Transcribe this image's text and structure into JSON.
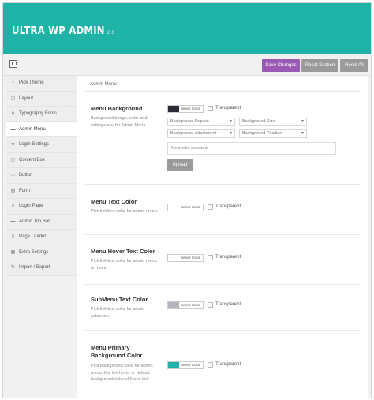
{
  "app": {
    "title": "ULTRA WP ADMIN",
    "version": "2.0"
  },
  "toolbar": {
    "save_label": "Save Changes",
    "reset_section_label": "Reset Section",
    "reset_all_label": "Reset All"
  },
  "sidebar": {
    "items": [
      {
        "label": "Pick Theme",
        "icon": "paint-icon",
        "glyph": "▪"
      },
      {
        "label": "Layout",
        "icon": "layout-icon",
        "glyph": "▢"
      },
      {
        "label": "Typography Fonts",
        "icon": "font-icon",
        "glyph": "A"
      },
      {
        "label": "Admin Menu",
        "icon": "menu-icon",
        "glyph": "▬"
      },
      {
        "label": "Login Settings",
        "icon": "star-icon",
        "glyph": "★"
      },
      {
        "label": "Content Box",
        "icon": "box-icon",
        "glyph": "▢"
      },
      {
        "label": "Button",
        "icon": "button-icon",
        "glyph": "▭"
      },
      {
        "label": "Form",
        "icon": "form-icon",
        "glyph": "▤"
      },
      {
        "label": "Login Page",
        "icon": "page-icon",
        "glyph": "▯"
      },
      {
        "label": "Admin Top Bar",
        "icon": "topbar-icon",
        "glyph": "▬"
      },
      {
        "label": "Page Loader",
        "icon": "loader-icon",
        "glyph": "▯"
      },
      {
        "label": "Extra Settings",
        "icon": "gear-icon",
        "glyph": "▦"
      },
      {
        "label": "Import / Export",
        "icon": "refresh-icon",
        "glyph": "↻"
      }
    ],
    "active_index": 3
  },
  "main": {
    "section_title": "Admin Menu",
    "select_color_label": "Select Color",
    "transparent_label": "Transparent",
    "options": {
      "menu_bg": {
        "title": "Menu Background",
        "desc": "Background image, color and settings etc. for Admin Menu",
        "color": "#2b2b33",
        "selects": [
          "Background Repeat",
          "Background Size",
          "Background Attachment",
          "Background Position"
        ],
        "media_placeholder": "No media selected",
        "upload_label": "Upload"
      },
      "menu_text": {
        "title": "Menu Text Color",
        "desc": "Pick link/text color for admin menu.",
        "color": "#ffffff"
      },
      "menu_hover": {
        "title": "Menu Hover Text Color",
        "desc": "Pick link/text color for admin menu on hover.",
        "color": "#ffffff"
      },
      "submenu_text": {
        "title": "SubMenu Text Color",
        "desc": "Pick link/text color for admin submenu.",
        "color": "#b4b4bc"
      },
      "menu_primary_bg": {
        "title_line1": "Menu Primary",
        "title_line2": "Background Color",
        "desc": "Pick background color for admin menu. It is the hover or default background color of Menu link",
        "color": "#1fb2a6"
      }
    }
  },
  "colors": {
    "header": "#1fb2a6",
    "save_button": "#9b59b6",
    "secondary_button": "#9a9a9a"
  }
}
